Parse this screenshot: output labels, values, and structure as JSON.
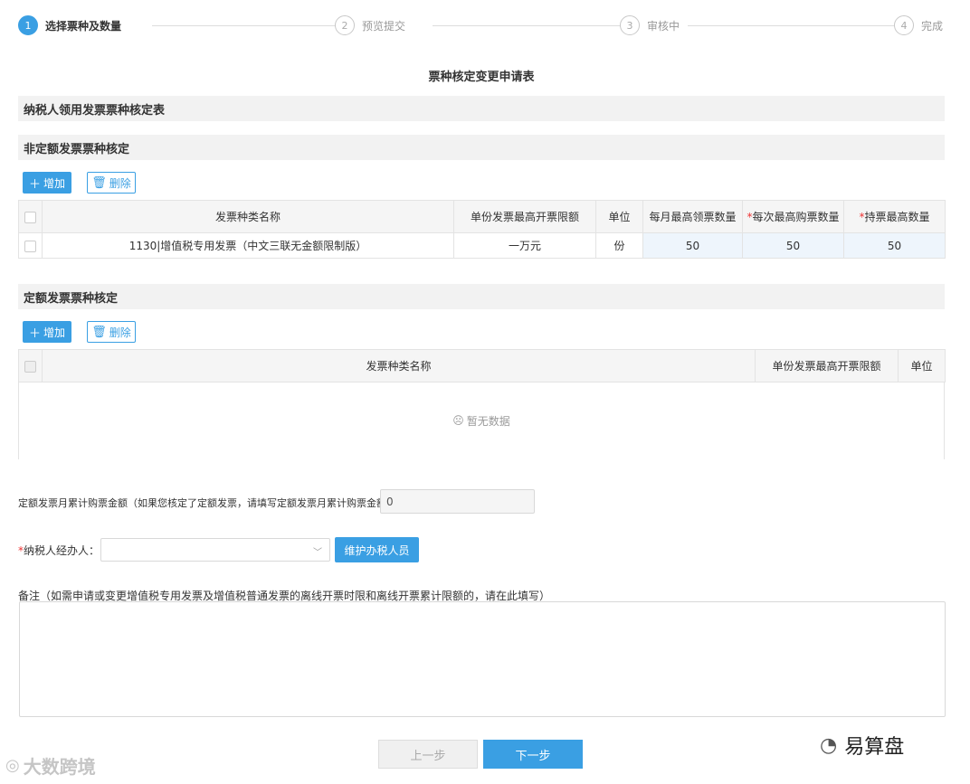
{
  "steps": [
    {
      "num": "1",
      "label": "选择票种及数量"
    },
    {
      "num": "2",
      "label": "预览提交"
    },
    {
      "num": "3",
      "label": "审核中"
    },
    {
      "num": "4",
      "label": "完成"
    }
  ],
  "form_title": "票种核定变更申请表",
  "section_main": "纳税人领用发票票种核定表",
  "section_nonfixed": "非定额发票票种核定",
  "section_fixed": "定额发票票种核定",
  "buttons": {
    "add": "增加",
    "delete": "删除",
    "maintain": "维护办税人员",
    "prev": "上一步",
    "next": "下一步"
  },
  "nonfixed_table": {
    "headers": [
      "发票种类名称",
      "单份发票最高开票限额",
      "单位",
      "每月最高领票数量",
      "每次最高购票数量",
      "持票最高数量"
    ],
    "required_mark": "*",
    "rows": [
      [
        "1130|增值税专用发票（中文三联无金额限制版）",
        "一万元",
        "份",
        "50",
        "50",
        "50"
      ]
    ]
  },
  "fixed_table": {
    "headers": [
      "发票种类名称",
      "单份发票最高开票限额",
      "单位"
    ],
    "empty_text": "暂无数据"
  },
  "fixed_amount_label": "定额发票月累计购票金额（如果您核定了定额发票，请填写定额发票月累计购票金额）：",
  "fixed_amount_value": "0",
  "agent_label": "纳税人经办人：",
  "agent_required": "*",
  "remark_label": "备注（如需申请或变更增值税专用发票及增值税普通发票的离线开票时限和离线开票累计限额的，请在此填写）",
  "watermark_left": "大数跨境",
  "watermark_right": "易算盘",
  "colors": {
    "accent": "#3a9fe3",
    "required": "#e33333",
    "editable_cell": "#eef5fc"
  }
}
